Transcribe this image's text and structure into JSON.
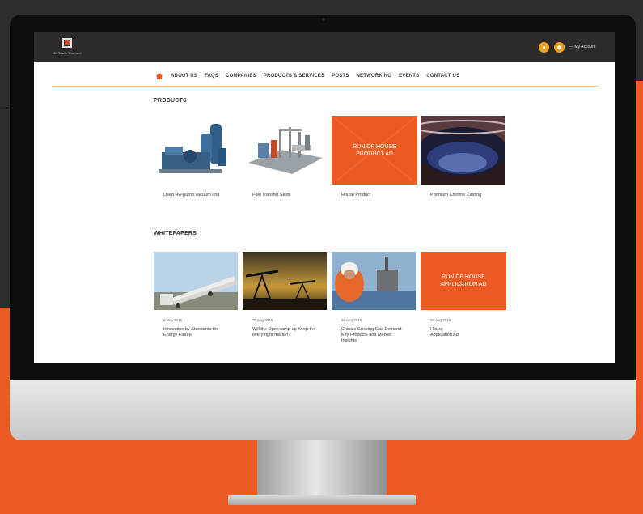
{
  "brand": {
    "logo_text": "Oil Trade Connect"
  },
  "header": {
    "user_icon_1": "person-icon",
    "user_icon_2": "person-icon",
    "account_label": "My Account"
  },
  "nav": {
    "items": [
      "ABOUT US",
      "FAQS",
      "COMPANIES",
      "PRODUCTS & SERVICES",
      "POSTS",
      "NETWORKING",
      "EVENTS",
      "CONTACT US"
    ]
  },
  "products": {
    "title": "PRODUCTS",
    "items": [
      {
        "label": "Used Hw-pump vacuum unit"
      },
      {
        "label": "Fuel Transfer Skids"
      },
      {
        "label": "House Product",
        "ad_text": "RUN OF HOUSE PRODUCT AD"
      },
      {
        "label": "Premium Chrome Casting"
      }
    ]
  },
  "whitepapers": {
    "title": "WHITEPAPERS",
    "items": [
      {
        "date": "9 Nov 2015",
        "label": "Innovation by Standards the Energy Future"
      },
      {
        "date": "20 Aug 2015",
        "label": "Will the Opec ramp-up Keep the every right market?"
      },
      {
        "date": "20 Aug 2015",
        "label": "China's Growing Gas Demand: Key Products and Market Insights"
      },
      {
        "date": "20 Aug 2015",
        "label": "House Application Ad",
        "ad_text": "RUN OF HOUSE APPLICATION AD"
      }
    ]
  },
  "colors": {
    "accent": "#ec5a24",
    "topbar": "#2d2a2b",
    "badge": "#f0a021"
  }
}
